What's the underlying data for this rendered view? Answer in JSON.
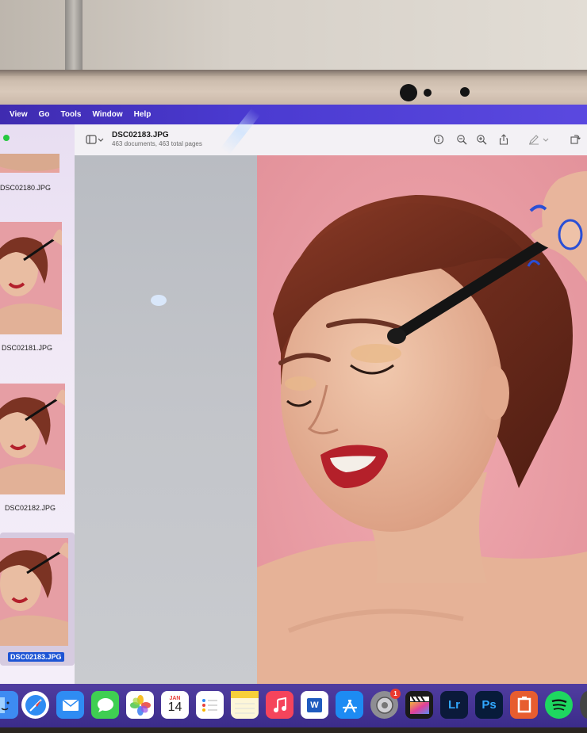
{
  "menubar": {
    "items": [
      "View",
      "Go",
      "Tools",
      "Window",
      "Help"
    ]
  },
  "toolbar": {
    "doc_title": "DSC02183.JPG",
    "doc_subtitle": "463 documents, 463 total pages",
    "icons": [
      "sidebar-icon",
      "chevron-down-icon",
      "info-icon",
      "zoom-out-icon",
      "zoom-in-icon",
      "share-icon",
      "markup-icon",
      "rotate-icon"
    ]
  },
  "sidebar": {
    "thumbnails": [
      {
        "label": "DSC02180.JPG",
        "selected": false
      },
      {
        "label": "DSC02181.JPG",
        "selected": false
      },
      {
        "label": "DSC02182.JPG",
        "selected": false
      },
      {
        "label": "DSC02183.JPG",
        "selected": true
      }
    ]
  },
  "dock": {
    "apps": [
      {
        "name": "finder-icon",
        "bg": "#3d8bf2"
      },
      {
        "name": "safari-icon",
        "bg": "#ffffff"
      },
      {
        "name": "mail-icon",
        "bg": "#2f8cf3"
      },
      {
        "name": "messages-icon",
        "bg": "#3fcf52"
      },
      {
        "name": "photos-icon",
        "bg": "#ffffff"
      },
      {
        "name": "calendar-icon",
        "bg": "#ffffff",
        "month": "JAN",
        "day": "14"
      },
      {
        "name": "reminders-icon",
        "bg": "#ffffff"
      },
      {
        "name": "notes-icon",
        "bg": "#fdf6d8"
      },
      {
        "name": "music-icon",
        "bg": "#f5445c"
      },
      {
        "name": "word-icon",
        "bg": "#ffffff",
        "text": "W"
      },
      {
        "name": "app-store-icon",
        "bg": "#1d8bf3"
      },
      {
        "name": "system-settings-icon",
        "bg": "#8e8e93",
        "badge": "1"
      },
      {
        "name": "final-cut-icon",
        "bg": "#1a1a1a"
      },
      {
        "name": "lightroom-icon",
        "bg": "#0b1a3a",
        "text": "Lr"
      },
      {
        "name": "photoshop-icon",
        "bg": "#071b3a",
        "text": "Ps"
      },
      {
        "name": "presentation-icon",
        "bg": "#e75d2f"
      },
      {
        "name": "spotify-icon",
        "bg": "#1ed760"
      }
    ]
  },
  "colors": {
    "menubar": "#4a3ad0",
    "photo_background": "#e9a1a5",
    "selection": "#1d54d4"
  }
}
